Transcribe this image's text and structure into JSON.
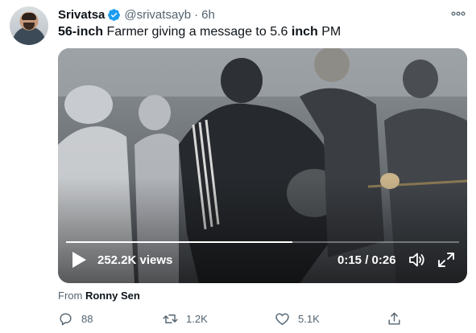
{
  "author": {
    "name": "Srivatsa",
    "handle": "@srivatsayb",
    "separator": "·",
    "time": "6h",
    "verified": true,
    "verified_color": "#1d9bf0"
  },
  "tweet": {
    "text_parts": {
      "p1": "56-inch",
      "p2": " Farmer giving a message to 5.6 ",
      "p3": "inch",
      "p4": " PM"
    }
  },
  "video": {
    "views": "252.2K views",
    "time_current": "0:15",
    "time_separator": " / ",
    "time_total": "0:26",
    "progress_fraction": 0.576
  },
  "source": {
    "prefix": "From ",
    "name": "Ronny Sen"
  },
  "actions": {
    "replies": "88",
    "retweets": "1.2K",
    "likes": "5.1K"
  },
  "colors": {
    "text": "#0f1419",
    "muted": "#536471",
    "accent": "#1d9bf0"
  },
  "icons": [
    "verified-badge-icon",
    "more-icon",
    "play-icon",
    "volume-icon",
    "fullscreen-icon",
    "reply-icon",
    "retweet-icon",
    "like-icon",
    "share-icon"
  ]
}
